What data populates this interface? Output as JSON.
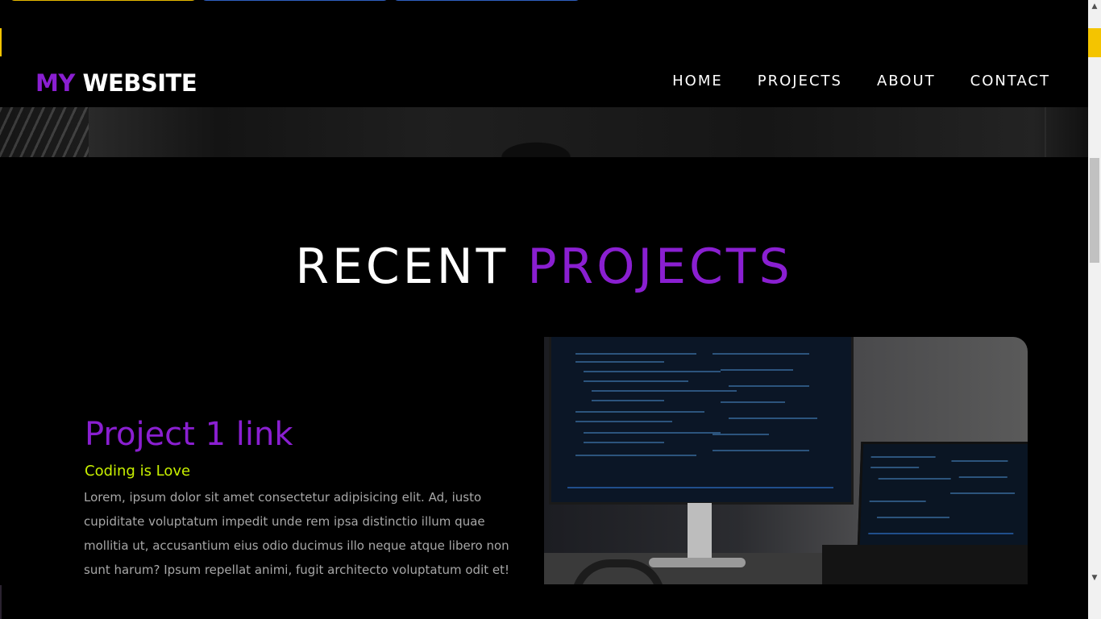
{
  "brand": {
    "my": "MY",
    "website": "WEBSITE"
  },
  "nav": {
    "items": [
      {
        "label": "HOME"
      },
      {
        "label": "PROJECTS"
      },
      {
        "label": "ABOUT"
      },
      {
        "label": "CONTACT"
      }
    ]
  },
  "section": {
    "title_white": "RECENT",
    "title_accent": "PROJECTS"
  },
  "project": {
    "title": "Project 1 link",
    "subtitle": "Coding is Love",
    "description": "Lorem, ipsum dolor sit amet consectetur adipisicing elit. Ad, iusto cupiditate voluptatum impedit unde rem ipsa distinctio illum quae mollitia ut, accusantium eius odio ducimus illo neque atque libero non sunt harum? Ipsum repellat animi, fugit architecto voluptatum odit et!"
  },
  "colors": {
    "accent": "#8a1fd1",
    "subtitle": "#c8f000",
    "background": "#000000",
    "body_text": "#a7a7a7"
  },
  "icons": {
    "scroll_up": "scroll-up-arrow-icon",
    "scroll_down": "scroll-down-arrow-icon"
  }
}
